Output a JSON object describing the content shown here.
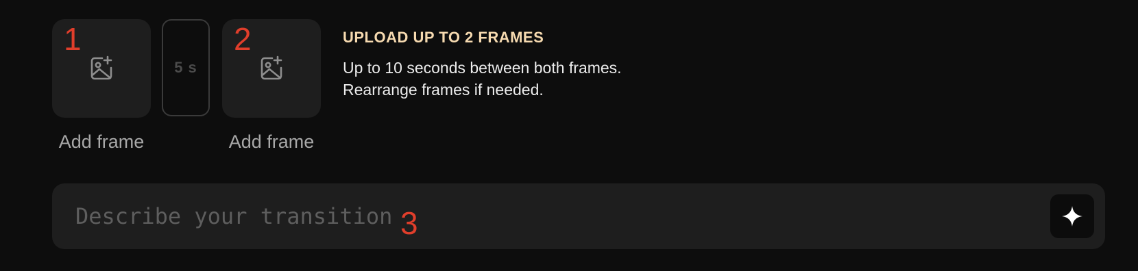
{
  "frames": [
    {
      "number": "1",
      "caption": "Add frame",
      "icon": "add-image-icon"
    },
    {
      "number": "2",
      "caption": "Add frame",
      "icon": "add-image-icon"
    }
  ],
  "duration": {
    "label": "5 s"
  },
  "info": {
    "title": "UPLOAD UP TO 2 FRAMES",
    "line1": "Up to 10 seconds between both frames.",
    "line2": "Rearrange frames if needed."
  },
  "prompt": {
    "placeholder": "Describe your transition",
    "value": "",
    "number": "3",
    "generate_icon": "sparkle-icon"
  },
  "colors": {
    "background": "#0d0d0d",
    "panel": "#1e1e1e",
    "number_accent": "#e03e2b",
    "title_accent": "#f6dab0"
  }
}
